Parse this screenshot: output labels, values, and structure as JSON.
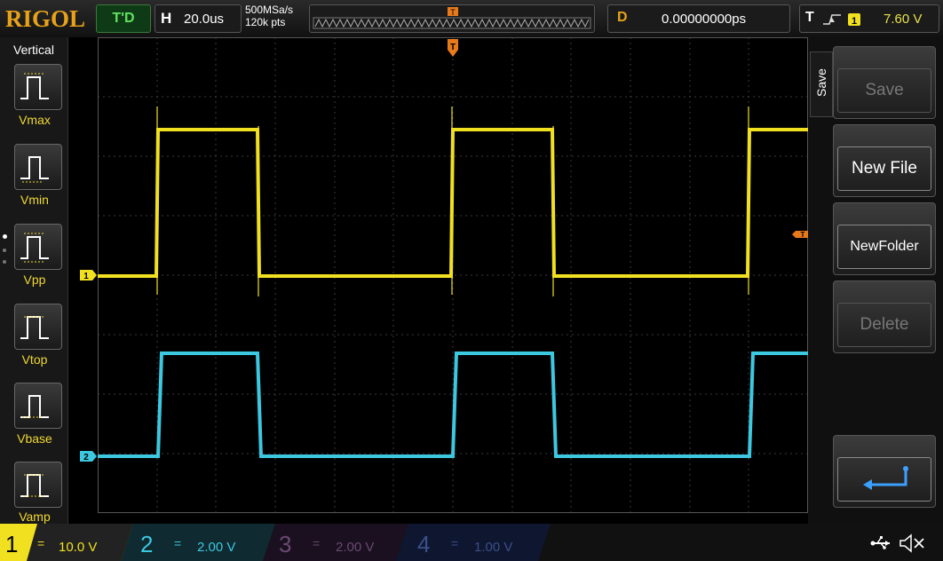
{
  "brand": "RIGOL",
  "status": "T'D",
  "horizontal": {
    "key": "H",
    "timebase": "20.0us"
  },
  "acquisition": {
    "sample_rate": "500MSa/s",
    "memory_depth": "120k pts"
  },
  "delay": {
    "key": "D",
    "value": "0.00000000ps"
  },
  "trigger": {
    "key": "T",
    "source": "1",
    "level": "7.60 V"
  },
  "trigger_marker": "T",
  "left_menu": {
    "title": "Vertical",
    "items": [
      {
        "label": "Vmax"
      },
      {
        "label": "Vmin"
      },
      {
        "label": "Vpp"
      },
      {
        "label": "Vtop"
      },
      {
        "label": "Vbase"
      },
      {
        "label": "Vamp"
      }
    ]
  },
  "right_menu": {
    "title": "Save",
    "items": [
      {
        "label": "Save",
        "enabled": false
      },
      {
        "label": "New File",
        "enabled": true
      },
      {
        "label": "NewFolder",
        "enabled": true
      },
      {
        "label": "Delete",
        "enabled": false
      }
    ],
    "back_icon": "return-arrow-icon"
  },
  "channels": [
    {
      "num": "1",
      "scale": "10.0 V",
      "color": "#f0e020",
      "active": true
    },
    {
      "num": "2",
      "scale": "2.00 V",
      "color": "#3cc8e0",
      "active": true
    },
    {
      "num": "3",
      "scale": "2.00 V",
      "color": "#b060c0",
      "active": false
    },
    {
      "num": "4",
      "scale": "1.00 V",
      "color": "#4070d0",
      "active": false
    }
  ],
  "channel_markers": {
    "ch1": "1",
    "ch2": "2"
  },
  "status_icons": [
    "usb-icon",
    "mute-icon"
  ],
  "colors": {
    "brand": "#e8a21a",
    "ch1": "#f0e020",
    "ch2": "#3cc8e0",
    "grid": "#3a3a3a"
  }
}
